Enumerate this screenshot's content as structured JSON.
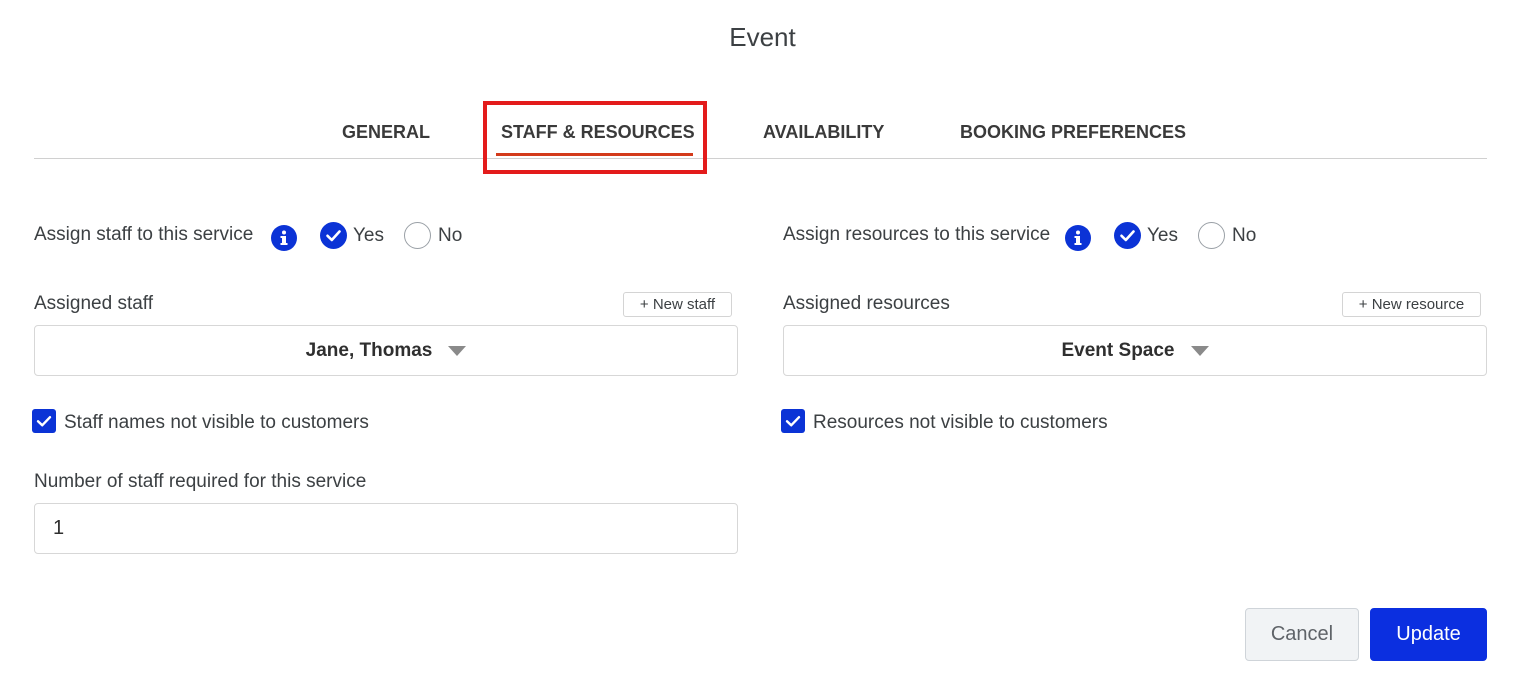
{
  "dialog": {
    "title": "Event"
  },
  "tabs": [
    {
      "label": "GENERAL"
    },
    {
      "label": "STAFF & RESOURCES",
      "active": true
    },
    {
      "label": "AVAILABILITY"
    },
    {
      "label": "BOOKING PREFERENCES"
    }
  ],
  "staff": {
    "assign_label": "Assign staff to this service",
    "yes_label": "Yes",
    "no_label": "No",
    "assign_value": "Yes",
    "assigned_label": "Assigned staff",
    "new_button": "+ New staff",
    "assigned_value": "Jane, Thomas",
    "not_visible_label": "Staff names not visible to customers",
    "not_visible_checked": true,
    "required_label": "Number of staff required for this service",
    "required_value": "1"
  },
  "resources": {
    "assign_label": "Assign resources to this service",
    "yes_label": "Yes",
    "no_label": "No",
    "assign_value": "Yes",
    "assigned_label": "Assigned resources",
    "new_button": "+ New resource",
    "assigned_value": "Event Space",
    "not_visible_label": "Resources not visible to customers",
    "not_visible_checked": true
  },
  "footer": {
    "cancel_label": "Cancel",
    "update_label": "Update"
  },
  "colors": {
    "accent": "#0b33d6",
    "active_tab_underline": "#d33a1b",
    "highlight_box": "#e31b1b"
  },
  "icons": {
    "info": "info-icon",
    "radio_checked": "check-icon",
    "checkbox_checked": "check-icon",
    "dropdown": "chevron-down-icon"
  }
}
